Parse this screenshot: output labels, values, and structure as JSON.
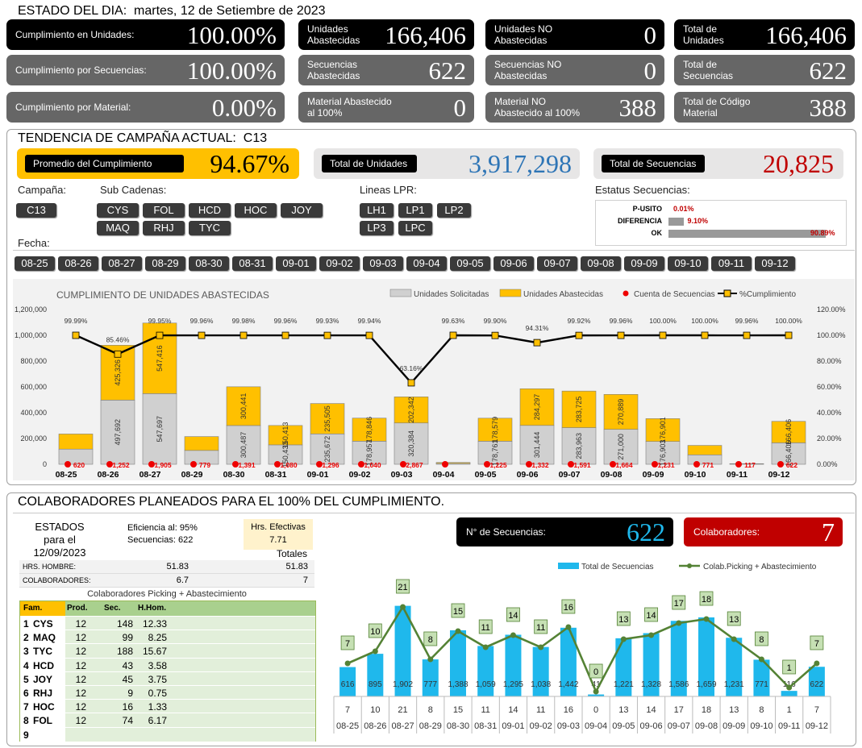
{
  "header": {
    "title": "ESTADO DEL DIA:",
    "date": "martes, 12 de Setiembre de 2023"
  },
  "kpis": [
    {
      "label": "Cumplimiento en Unidades:",
      "value": "100.00%"
    },
    {
      "label": "Unidades\nAbastecidas",
      "value": "166,406"
    },
    {
      "label": "Unidades NO\nAbastecidas",
      "value": "0"
    },
    {
      "label": "Total de\nUnidades",
      "value": "166,406"
    },
    {
      "label": "Cumplimiento por Secuencias:",
      "value": "100.00%"
    },
    {
      "label": "Secuencias\nAbastecidas",
      "value": "622"
    },
    {
      "label": "Secuencias NO\nAbastecidas",
      "value": "0"
    },
    {
      "label": "Total de\nSecuencias",
      "value": "622"
    },
    {
      "label": "Cumplimiento por Material:",
      "value": "0.00%"
    },
    {
      "label": "Material Abastecido\nal 100%",
      "value": "0"
    },
    {
      "label": "Material NO\nAbastecido al 100%",
      "value": "388"
    },
    {
      "label": "Total de Código\nMaterial",
      "value": "388"
    }
  ],
  "trend": {
    "title": "TENDENCIA DE CAMPAÑA ACTUAL:",
    "campaign": "C13",
    "promedio_label": "Promedio  del Cumplimiento",
    "promedio_value": "94.67%",
    "units_label": "Total de Unidades",
    "units_value": "3,917,298",
    "seq_label": "Total de Secuencias",
    "seq_value": "20,825"
  },
  "filters": {
    "campana_label": "Campaña:",
    "campanas": [
      "C13"
    ],
    "subcad_label": "Sub Cadenas:",
    "subcadenas": [
      "CYS",
      "FOL",
      "HCD",
      "HOC",
      "JOY",
      "MAQ",
      "RHJ",
      "TYC"
    ],
    "lpr_label": "Lineas LPR:",
    "lpr": [
      "LH1",
      "LP1",
      "LP2",
      "LP3",
      "LPC"
    ],
    "estatus_label": "Estatus Secuencias:",
    "estatus": [
      {
        "name": "P-USITO",
        "value": "0.01%",
        "pct": 0.01
      },
      {
        "name": "DIFERENCIA",
        "value": "9.10%",
        "pct": 9.1
      },
      {
        "name": "OK",
        "value": "90.89%",
        "pct": 90.89
      }
    ],
    "fecha_label": "Fecha:",
    "fechas": [
      "08-25",
      "08-26",
      "08-27",
      "08-29",
      "08-30",
      "08-31",
      "09-01",
      "09-02",
      "09-03",
      "09-04",
      "09-05",
      "09-06",
      "09-07",
      "09-08",
      "09-09",
      "09-10",
      "09-11",
      "09-12"
    ]
  },
  "chart_data": [
    {
      "type": "bar",
      "title": "CUMPLIMIENTO DE UNIDADES ABASTECIDAS",
      "legend": [
        "Unidades Solicitadas",
        "Unidades Abastecidas",
        "Cuenta de Secuencias",
        "%Cumplimiento"
      ],
      "categories": [
        "08-25",
        "08-26",
        "08-27",
        "08-29",
        "08-30",
        "08-31",
        "09-01",
        "09-02",
        "09-03",
        "09-04",
        "09-05",
        "09-06",
        "09-07",
        "09-08",
        "09-09",
        "09-10",
        "09-11",
        "09-12"
      ],
      "ylim": [
        0,
        1200000
      ],
      "y2lim": [
        0,
        120
      ],
      "yticks": [
        "0",
        "200,000",
        "400,000",
        "600,000",
        "800,000",
        "1,000,000",
        "1,200,000"
      ],
      "y2ticks": [
        "0.00%",
        "20.00%",
        "40.00%",
        "60.00%",
        "80.00%",
        "100.00%",
        "120.00%"
      ],
      "series": [
        {
          "name": "Unidades Solicitadas",
          "values": [
            117427,
            497692,
            547697,
            107381,
            300487,
            150433,
            235672,
            178957,
            320384,
            6956,
            178761,
            301444,
            283963,
            271000,
            176903,
            73171,
            2326,
            166406
          ],
          "labels": [
            "117,427",
            "497,692",
            "547,697",
            "107,381",
            "300,487",
            "150,433",
            "235,672",
            "178,957",
            "320,384",
            "6,956",
            "178,761",
            "301,444",
            "283,963",
            "271,000",
            "176,903",
            "73,171",
            "2,326",
            "166,406"
          ]
        },
        {
          "name": "Unidades Abastecidas",
          "values": [
            117417,
            425326,
            547416,
            107360,
            300441,
            150413,
            235505,
            178846,
            202342,
            6956,
            178579,
            284297,
            283725,
            270889,
            176901,
            73171,
            2326,
            166406
          ],
          "labels": [
            "117,417",
            "425,326",
            "547,416",
            "107,360",
            "300,441",
            "150,413",
            "235,505",
            "178,846",
            "202,342",
            "6,956",
            "178,579",
            "284,297",
            "283,725",
            "270,889",
            "176,901",
            "73,171",
            "2,326",
            "166,406"
          ]
        },
        {
          "name": "Cuenta de Secuencias",
          "values": [
            620,
            1252,
            1905,
            779,
            1391,
            1080,
            1296,
            1040,
            2867,
            41,
            1225,
            1332,
            1591,
            1664,
            1231,
            771,
            117,
            622
          ],
          "labels": [
            "620",
            "1,252",
            "1,905",
            "779",
            "1,391",
            "1,080",
            "1,296",
            "1,040",
            "2,867",
            "",
            "1,225",
            "1,332",
            "1,591",
            "1,664",
            "1,231",
            "771",
            "117",
            "622"
          ]
        },
        {
          "name": "%Cumplimiento",
          "values": [
            99.99,
            85.46,
            99.95,
            99.96,
            99.98,
            99.96,
            99.93,
            99.94,
            63.16,
            100.0,
            99.9,
            94.31,
            99.92,
            99.96,
            100.0,
            100.0,
            99.96,
            100.0
          ],
          "labels": [
            "99.99%",
            "85.46%",
            "99.95%",
            "99.96%",
            "99.98%",
            "99.96%",
            "99.93%",
            "99.94%",
            "63.16%",
            "99.63%",
            "99.90%",
            "94.31%",
            "99.92%",
            "99.96%",
            "100.00%",
            "100.00%",
            "99.96%",
            "100.00%"
          ]
        }
      ]
    },
    {
      "type": "bar",
      "legend": [
        "Total de Secuencias",
        "Colab.Picking + Abastecimiento"
      ],
      "categories": [
        "08-25",
        "08-26",
        "08-27",
        "08-29",
        "08-30",
        "08-31",
        "09-01",
        "09-02",
        "09-03",
        "09-04",
        "09-05",
        "09-06",
        "09-07",
        "09-08",
        "09-09",
        "09-10",
        "09-11",
        "09-12"
      ],
      "series": [
        {
          "name": "Total de Secuencias",
          "values": [
            616,
            895,
            1902,
            777,
            1388,
            1059,
            1295,
            1038,
            1442,
            41,
            1221,
            1328,
            1586,
            1659,
            1231,
            771,
            116,
            622
          ],
          "labels": [
            "616",
            "895",
            "1,902",
            "777",
            "1,388",
            "1,059",
            "1,295",
            "1,038",
            "1,442",
            "41",
            "1,221",
            "1,328",
            "1,586",
            "1,659",
            "1,231",
            "771",
            "116",
            "622"
          ]
        },
        {
          "name": "Colab.Picking + Abastecimiento",
          "values": [
            7,
            10,
            21,
            8,
            15,
            11,
            14,
            11,
            16,
            0,
            13,
            14,
            17,
            18,
            13,
            8,
            1,
            7
          ]
        }
      ]
    }
  ],
  "colab": {
    "title": "COLABORADORES PLANEADOS PARA EL 100% DEL CUMPLIMIENTO.",
    "estados": "ESTADOS",
    "para": "para el",
    "fecha": "12/09/2023",
    "eficiencia_label": "Eficiencia al:",
    "eficiencia": "95%",
    "secuencias_label": "Secuencias:",
    "secuencias": "622",
    "hrs_label": "Hrs. Efectivas",
    "hrs": "7.71",
    "totales": "Totales",
    "hrs_hombre_label": "HRS. HOMBRE:",
    "hrs_hombre": "51.83",
    "hrs_hombre_total": "51.83",
    "colaboradores_label": "COLABORADORES:",
    "colaboradores": "6.7",
    "colaboradores_total": "7",
    "table_title": "Colaboradores Picking + Abastecimiento",
    "headers": [
      "Fam.",
      "Prod.",
      "Sec.",
      "H.Hom."
    ],
    "rows": [
      [
        "1",
        "CYS",
        "12",
        "148",
        "12.33"
      ],
      [
        "2",
        "MAQ",
        "12",
        "99",
        "8.25"
      ],
      [
        "3",
        "TYC",
        "12",
        "188",
        "15.67"
      ],
      [
        "4",
        "HCD",
        "12",
        "43",
        "3.58"
      ],
      [
        "5",
        "JOY",
        "12",
        "45",
        "3.75"
      ],
      [
        "6",
        "RHJ",
        "12",
        "9",
        "0.75"
      ],
      [
        "7",
        "HOC",
        "12",
        "16",
        "1.33"
      ],
      [
        "8",
        "FOL",
        "12",
        "74",
        "6.17"
      ],
      [
        "9",
        "",
        "",
        "",
        ""
      ]
    ],
    "nseq_label": "N° de Secuencias:",
    "nseq_value": "622",
    "colab_label": "Colaboradores:",
    "colab_value": "7"
  },
  "colors": {
    "gold": "#ffc000",
    "blue_value": "#2e75b6",
    "red_value": "#c00000",
    "cyan": "#1fb8ec",
    "green_line": "#548235",
    "bar_gray": "#d0d0d0"
  }
}
